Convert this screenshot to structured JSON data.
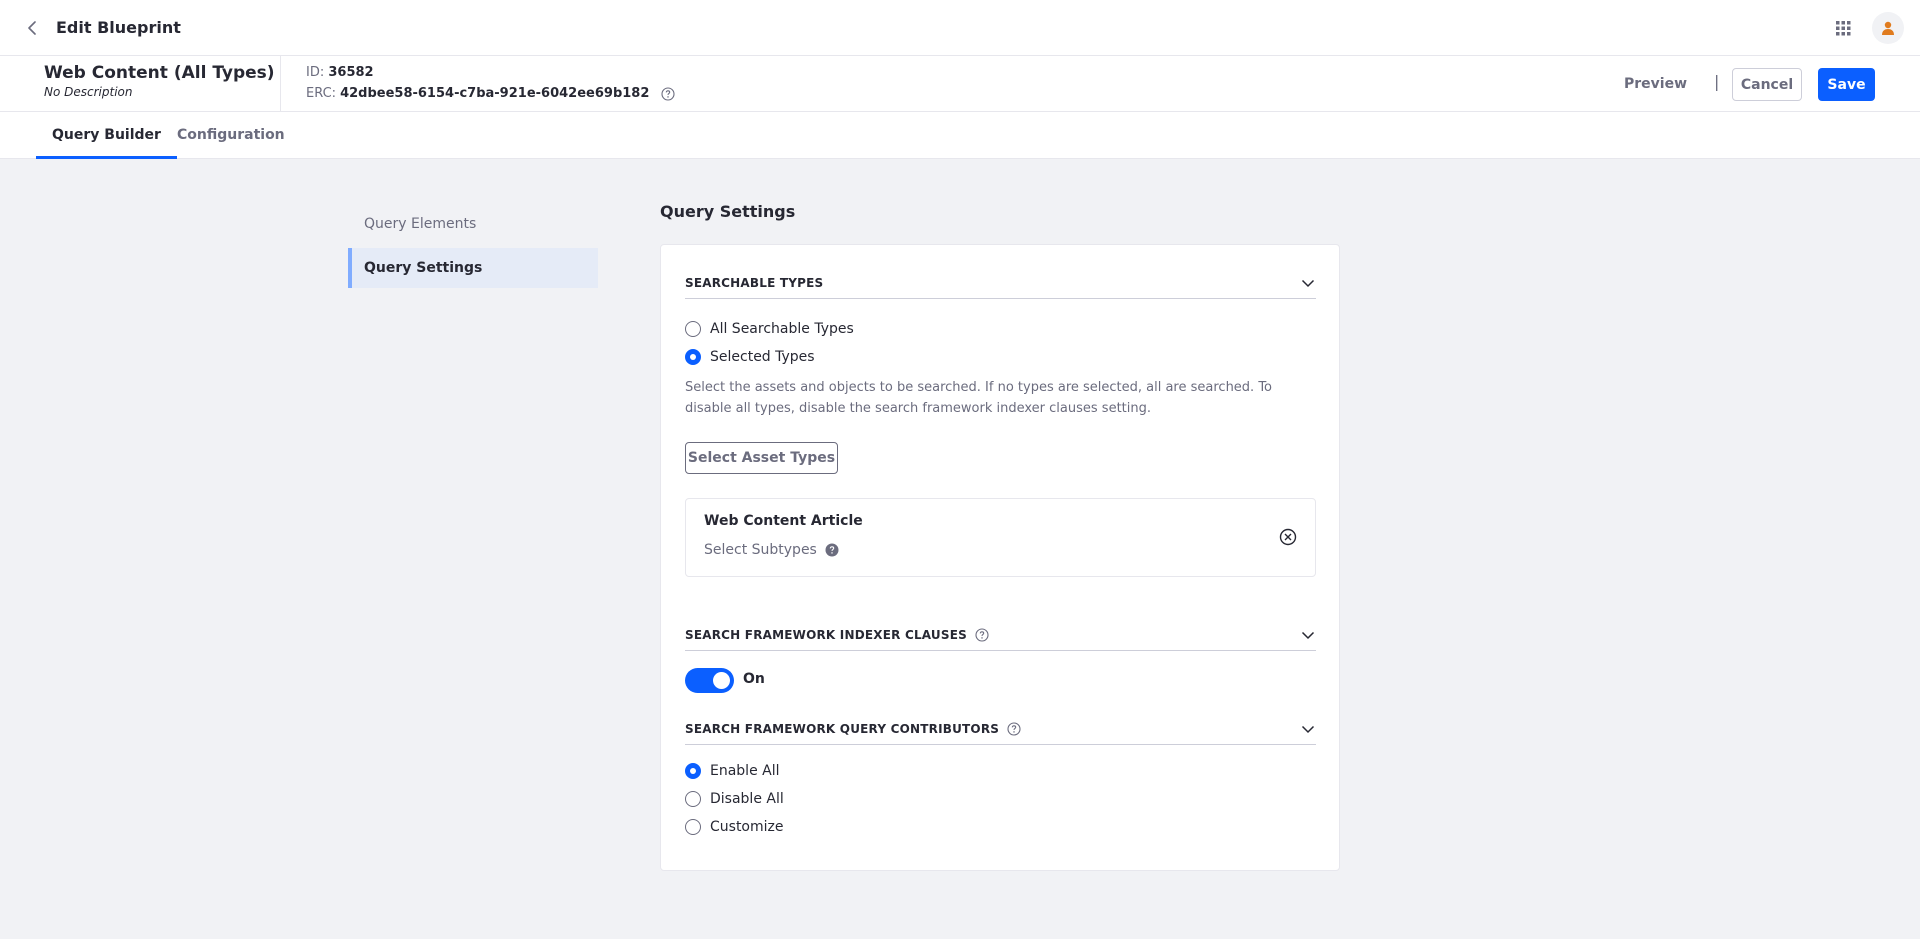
{
  "topbar": {
    "title": "Edit Blueprint"
  },
  "blueprint": {
    "name": "Web Content (All Types)",
    "description": "No Description",
    "id_label": "ID:",
    "id_value": "36582",
    "erc_label": "ERC:",
    "erc_value": "42dbee58-6154-c7ba-921e-6042ee69b182"
  },
  "actions": {
    "preview": "Preview",
    "separator": "|",
    "cancel": "Cancel",
    "save": "Save"
  },
  "tabs": [
    {
      "label": "Query Builder",
      "active": true
    },
    {
      "label": "Configuration",
      "active": false
    }
  ],
  "side_nav": [
    {
      "label": "Query Elements",
      "active": false
    },
    {
      "label": "Query Settings",
      "active": true
    }
  ],
  "main": {
    "title": "Query Settings",
    "searchable_types": {
      "header": "SEARCHABLE TYPES",
      "options": [
        {
          "label": "All Searchable Types",
          "checked": false
        },
        {
          "label": "Selected Types",
          "checked": true
        }
      ],
      "help": "Select the assets and objects to be searched. If no types are selected, all are searched. To disable all types, disable the search framework indexer clauses setting.",
      "select_button": "Select Asset Types",
      "selected_type": {
        "name": "Web Content Article",
        "subtypes_label": "Select Subtypes"
      }
    },
    "indexer_clauses": {
      "header": "SEARCH FRAMEWORK INDEXER CLAUSES",
      "toggle_on": true,
      "toggle_label": "On"
    },
    "query_contributors": {
      "header": "SEARCH FRAMEWORK QUERY CONTRIBUTORS",
      "options": [
        {
          "label": "Enable All",
          "checked": true
        },
        {
          "label": "Disable All",
          "checked": false
        },
        {
          "label": "Customize",
          "checked": false
        }
      ]
    }
  },
  "colors": {
    "primary": "#0b5fff",
    "background": "#f1f2f5",
    "avatar": "#e07b1e"
  },
  "icons": [
    "back-arrow-icon",
    "apps-grid-icon",
    "user-icon",
    "help-icon",
    "chevron-down-icon",
    "times-circle-icon"
  ]
}
